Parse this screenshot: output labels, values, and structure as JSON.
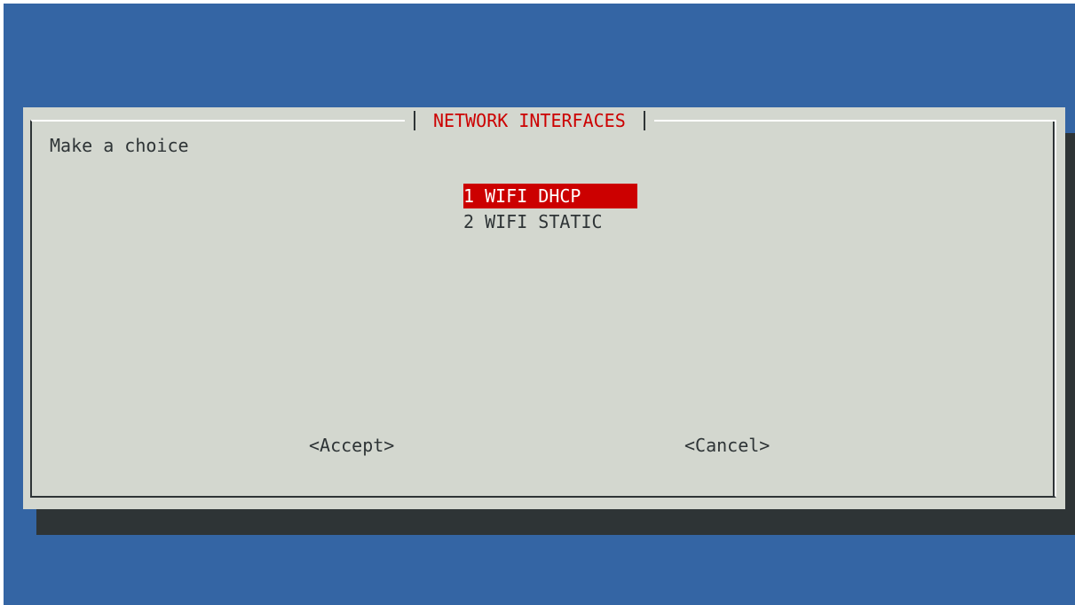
{
  "dialog": {
    "title": "NETWORK INTERFACES",
    "prompt": "Make a choice",
    "menu": [
      {
        "label": "1 WIFI DHCP",
        "selected": true
      },
      {
        "label": "2 WIFI STATIC",
        "selected": false
      }
    ],
    "buttons": {
      "accept": "<Accept>",
      "cancel": "<Cancel>"
    }
  },
  "colors": {
    "background": "#3465a4",
    "dialog": "#d3d7cf",
    "shadow": "#2e3436",
    "highlight": "#cc0000",
    "text": "#2e3436"
  }
}
